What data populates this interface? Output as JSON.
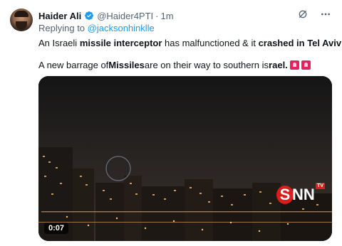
{
  "header": {
    "name": "Haider Ali",
    "handle": "@Haider4PTI",
    "separator": "·",
    "time": "1m"
  },
  "reply": {
    "prefix": "Replying to ",
    "to": "@jacksonhinklle"
  },
  "tweet": {
    "line1_a": "An Israeli ",
    "line1_b": "missile interceptor",
    "line1_c": " has malfunctioned & it ",
    "line1_d": "crashed in Tel Aviv",
    "line1_e": "..",
    "line2_a": "A new barrage of ",
    "line2_b": "Missiles",
    "line2_c": " are on their way to southern is",
    "line2_d": "rael."
  },
  "video": {
    "duration": "0:07",
    "watermark_letter": "S",
    "watermark_rest": "NN",
    "watermark_badge": "TV"
  },
  "icons": [
    "avatar",
    "verified-badge-icon",
    "grok-icon",
    "more-icon",
    "emoji-flags-icons"
  ],
  "colors": {
    "link": "#1d9bf0",
    "muted": "#536471",
    "text": "#0f1419",
    "flag": "#e0245e"
  }
}
